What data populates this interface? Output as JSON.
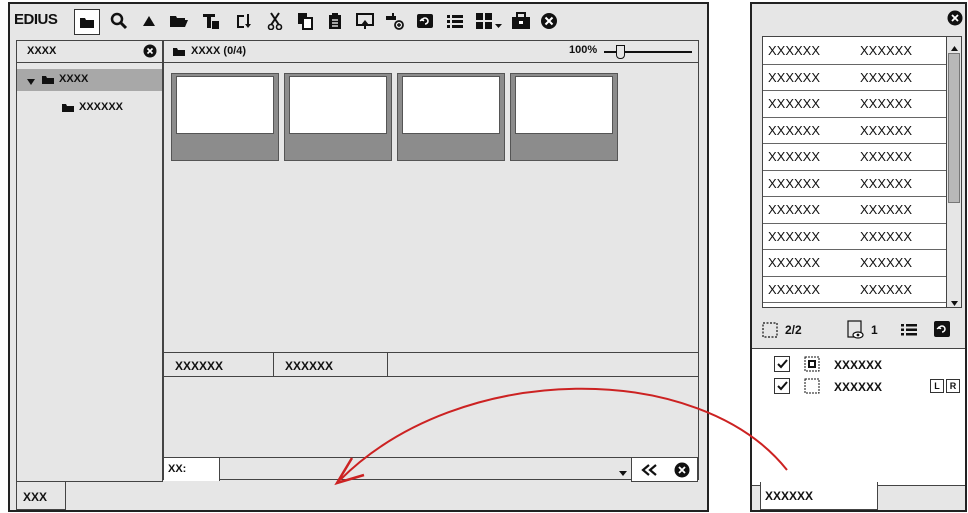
{
  "main": {
    "logo": "EDIUS",
    "tree": {
      "title": "XXXX",
      "root_label": "XXXX",
      "child_label": "XXXXXX",
      "bottom_tab": "XXX"
    },
    "bin": {
      "folder_title": "XXXX (0/4)",
      "zoom_value": "100%",
      "zoom_fraction": 0.15,
      "columns": [
        "XXXXXX",
        "XXXXXX"
      ],
      "filter_label": "XX:"
    }
  },
  "right": {
    "clips": [
      [
        "XXXXXX",
        "XXXXXX"
      ],
      [
        "XXXXXX",
        "XXXXXX"
      ],
      [
        "XXXXXX",
        "XXXXXX"
      ],
      [
        "XXXXXX",
        "XXXXXX"
      ],
      [
        "XXXXXX",
        "XXXXXX"
      ],
      [
        "XXXXXX",
        "XXXXXX"
      ],
      [
        "XXXXXX",
        "XXXXXX"
      ],
      [
        "XXXXXX",
        "XXXXXX"
      ],
      [
        "XXXXXX",
        "XXXXXX"
      ],
      [
        "XXXXXX",
        "XXXXXX"
      ]
    ],
    "status": {
      "count_a": "2/2",
      "count_b": "1"
    },
    "tracks": [
      {
        "label": "XXXXXX",
        "checked": true
      },
      {
        "label": "XXXXXX",
        "checked": true,
        "badge_l": "L",
        "badge_r": "R"
      }
    ],
    "bottom_tab": "XXXXXX"
  },
  "colors": {
    "window_bg": "#e6e6e6",
    "selection": "#a8a8a8",
    "thumb_frame": "#8c8c8c",
    "arrow": "#cc2222"
  }
}
